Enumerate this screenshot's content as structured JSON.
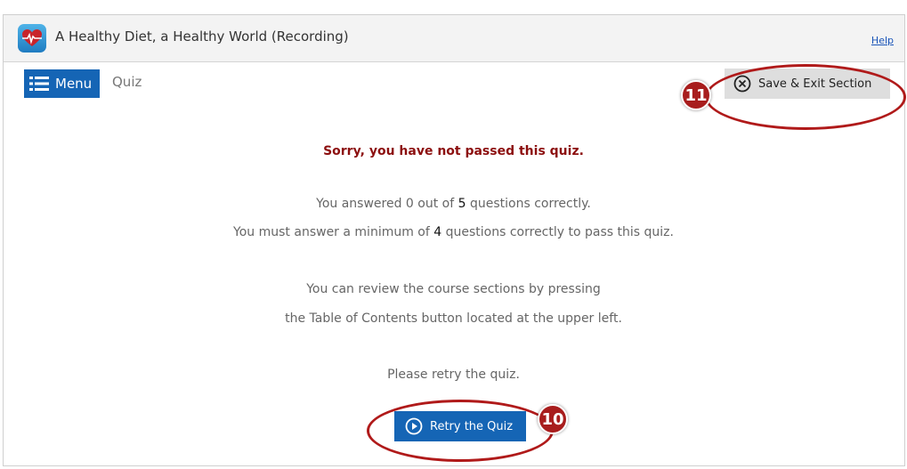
{
  "window": {
    "title": "A Healthy Diet, a Healthy World (Recording)",
    "help_label": "Help",
    "app_icon": "heart-icon"
  },
  "toolbar": {
    "menu_label": "Menu",
    "breadcrumb": "Quiz",
    "save_exit_label": "Save & Exit Section"
  },
  "result": {
    "heading": "Sorry, you have not passed this quiz.",
    "score_prefix": "You answered 0 out of ",
    "total_questions": "5",
    "score_suffix": " questions correctly.",
    "minimum_prefix": "You must answer a minimum of ",
    "minimum_required": "4",
    "minimum_suffix": " questions correctly to pass this quiz.",
    "review_line1": "You can review the course sections by pressing",
    "review_line2": "the Table of Contents button located at the upper left.",
    "retry_prompt": "Please retry the quiz.",
    "retry_label": "Retry the Quiz"
  },
  "annotations": {
    "exit_callout": "11",
    "retry_callout": "10",
    "color": "#a81d1d"
  },
  "colors": {
    "primary_button": "#1565b5",
    "heading_text": "#8c0f0f"
  }
}
